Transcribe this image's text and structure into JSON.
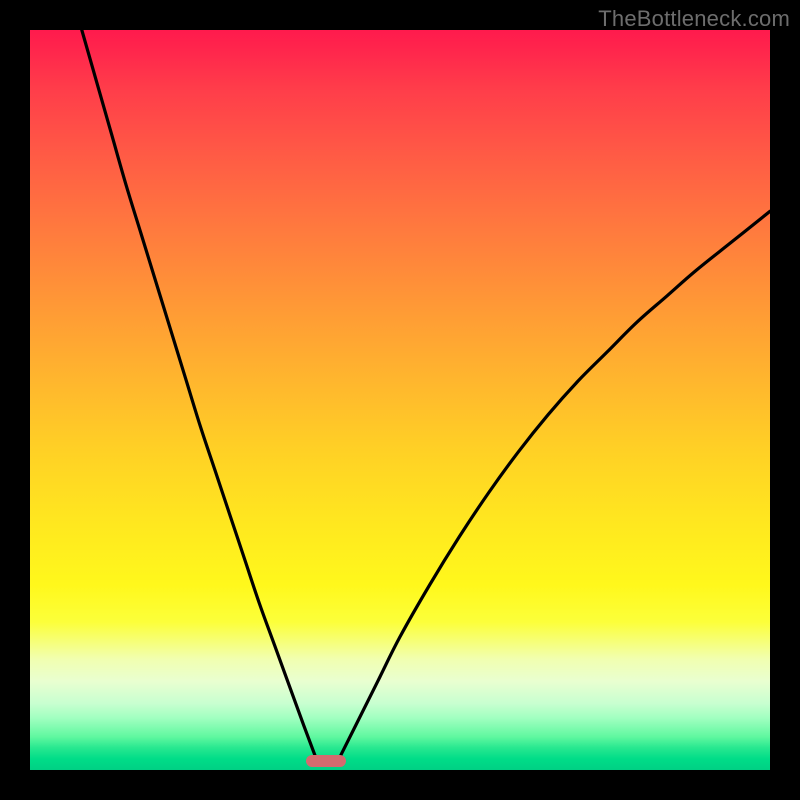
{
  "watermark": "TheBottleneck.com",
  "chart_data": {
    "type": "line",
    "title": "",
    "xlabel": "",
    "ylabel": "",
    "xlim": [
      0,
      100
    ],
    "ylim": [
      0,
      100
    ],
    "grid": false,
    "legend": false,
    "series": [
      {
        "name": "left-curve",
        "x": [
          7,
          9,
          11,
          13,
          15,
          17,
          19,
          21,
          23,
          25,
          27,
          29,
          31,
          33,
          35,
          37,
          38.5
        ],
        "y": [
          100,
          93,
          86,
          79,
          72.5,
          66,
          59.5,
          53,
          46.5,
          40.5,
          34.5,
          28.5,
          22.5,
          17,
          11.5,
          6,
          2
        ]
      },
      {
        "name": "right-curve",
        "x": [
          42,
          44,
          47,
          50,
          54,
          58,
          62,
          66,
          70,
          74,
          78,
          82,
          86,
          90,
          95,
          100
        ],
        "y": [
          2,
          6,
          12,
          18,
          25,
          31.5,
          37.5,
          43,
          48,
          52.5,
          56.5,
          60.5,
          64,
          67.5,
          71.5,
          75.5
        ]
      }
    ],
    "marker": {
      "x": 40,
      "y": 1.2,
      "width_pct": 5.4,
      "height_pct": 1.6,
      "color": "#d36b6f"
    }
  }
}
